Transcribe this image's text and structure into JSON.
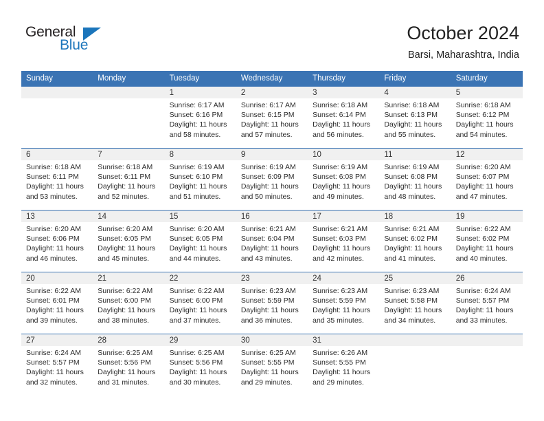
{
  "brand": {
    "name_top": "General",
    "name_bottom": "Blue",
    "triangle_icon": "triangle-icon",
    "color_top": "#231f20",
    "color_bottom": "#1b75bb"
  },
  "header": {
    "title": "October 2024",
    "subtitle": "Barsi, Maharashtra, India"
  },
  "theme": {
    "header_blue": "#3b74b4",
    "day_band_gray": "#f0f0f0",
    "text": "#2b2b2b"
  },
  "calendar": {
    "weekday_headers": [
      "Sunday",
      "Monday",
      "Tuesday",
      "Wednesday",
      "Thursday",
      "Friday",
      "Saturday"
    ],
    "weeks": [
      [
        {
          "day": "",
          "sunrise": "",
          "sunset": "",
          "daylight_line1": "",
          "daylight_line2": ""
        },
        {
          "day": "",
          "sunrise": "",
          "sunset": "",
          "daylight_line1": "",
          "daylight_line2": ""
        },
        {
          "day": "1",
          "sunrise": "Sunrise: 6:17 AM",
          "sunset": "Sunset: 6:16 PM",
          "daylight_line1": "Daylight: 11 hours",
          "daylight_line2": "and 58 minutes."
        },
        {
          "day": "2",
          "sunrise": "Sunrise: 6:17 AM",
          "sunset": "Sunset: 6:15 PM",
          "daylight_line1": "Daylight: 11 hours",
          "daylight_line2": "and 57 minutes."
        },
        {
          "day": "3",
          "sunrise": "Sunrise: 6:18 AM",
          "sunset": "Sunset: 6:14 PM",
          "daylight_line1": "Daylight: 11 hours",
          "daylight_line2": "and 56 minutes."
        },
        {
          "day": "4",
          "sunrise": "Sunrise: 6:18 AM",
          "sunset": "Sunset: 6:13 PM",
          "daylight_line1": "Daylight: 11 hours",
          "daylight_line2": "and 55 minutes."
        },
        {
          "day": "5",
          "sunrise": "Sunrise: 6:18 AM",
          "sunset": "Sunset: 6:12 PM",
          "daylight_line1": "Daylight: 11 hours",
          "daylight_line2": "and 54 minutes."
        }
      ],
      [
        {
          "day": "6",
          "sunrise": "Sunrise: 6:18 AM",
          "sunset": "Sunset: 6:11 PM",
          "daylight_line1": "Daylight: 11 hours",
          "daylight_line2": "and 53 minutes."
        },
        {
          "day": "7",
          "sunrise": "Sunrise: 6:18 AM",
          "sunset": "Sunset: 6:11 PM",
          "daylight_line1": "Daylight: 11 hours",
          "daylight_line2": "and 52 minutes."
        },
        {
          "day": "8",
          "sunrise": "Sunrise: 6:19 AM",
          "sunset": "Sunset: 6:10 PM",
          "daylight_line1": "Daylight: 11 hours",
          "daylight_line2": "and 51 minutes."
        },
        {
          "day": "9",
          "sunrise": "Sunrise: 6:19 AM",
          "sunset": "Sunset: 6:09 PM",
          "daylight_line1": "Daylight: 11 hours",
          "daylight_line2": "and 50 minutes."
        },
        {
          "day": "10",
          "sunrise": "Sunrise: 6:19 AM",
          "sunset": "Sunset: 6:08 PM",
          "daylight_line1": "Daylight: 11 hours",
          "daylight_line2": "and 49 minutes."
        },
        {
          "day": "11",
          "sunrise": "Sunrise: 6:19 AM",
          "sunset": "Sunset: 6:08 PM",
          "daylight_line1": "Daylight: 11 hours",
          "daylight_line2": "and 48 minutes."
        },
        {
          "day": "12",
          "sunrise": "Sunrise: 6:20 AM",
          "sunset": "Sunset: 6:07 PM",
          "daylight_line1": "Daylight: 11 hours",
          "daylight_line2": "and 47 minutes."
        }
      ],
      [
        {
          "day": "13",
          "sunrise": "Sunrise: 6:20 AM",
          "sunset": "Sunset: 6:06 PM",
          "daylight_line1": "Daylight: 11 hours",
          "daylight_line2": "and 46 minutes."
        },
        {
          "day": "14",
          "sunrise": "Sunrise: 6:20 AM",
          "sunset": "Sunset: 6:05 PM",
          "daylight_line1": "Daylight: 11 hours",
          "daylight_line2": "and 45 minutes."
        },
        {
          "day": "15",
          "sunrise": "Sunrise: 6:20 AM",
          "sunset": "Sunset: 6:05 PM",
          "daylight_line1": "Daylight: 11 hours",
          "daylight_line2": "and 44 minutes."
        },
        {
          "day": "16",
          "sunrise": "Sunrise: 6:21 AM",
          "sunset": "Sunset: 6:04 PM",
          "daylight_line1": "Daylight: 11 hours",
          "daylight_line2": "and 43 minutes."
        },
        {
          "day": "17",
          "sunrise": "Sunrise: 6:21 AM",
          "sunset": "Sunset: 6:03 PM",
          "daylight_line1": "Daylight: 11 hours",
          "daylight_line2": "and 42 minutes."
        },
        {
          "day": "18",
          "sunrise": "Sunrise: 6:21 AM",
          "sunset": "Sunset: 6:02 PM",
          "daylight_line1": "Daylight: 11 hours",
          "daylight_line2": "and 41 minutes."
        },
        {
          "day": "19",
          "sunrise": "Sunrise: 6:22 AM",
          "sunset": "Sunset: 6:02 PM",
          "daylight_line1": "Daylight: 11 hours",
          "daylight_line2": "and 40 minutes."
        }
      ],
      [
        {
          "day": "20",
          "sunrise": "Sunrise: 6:22 AM",
          "sunset": "Sunset: 6:01 PM",
          "daylight_line1": "Daylight: 11 hours",
          "daylight_line2": "and 39 minutes."
        },
        {
          "day": "21",
          "sunrise": "Sunrise: 6:22 AM",
          "sunset": "Sunset: 6:00 PM",
          "daylight_line1": "Daylight: 11 hours",
          "daylight_line2": "and 38 minutes."
        },
        {
          "day": "22",
          "sunrise": "Sunrise: 6:22 AM",
          "sunset": "Sunset: 6:00 PM",
          "daylight_line1": "Daylight: 11 hours",
          "daylight_line2": "and 37 minutes."
        },
        {
          "day": "23",
          "sunrise": "Sunrise: 6:23 AM",
          "sunset": "Sunset: 5:59 PM",
          "daylight_line1": "Daylight: 11 hours",
          "daylight_line2": "and 36 minutes."
        },
        {
          "day": "24",
          "sunrise": "Sunrise: 6:23 AM",
          "sunset": "Sunset: 5:59 PM",
          "daylight_line1": "Daylight: 11 hours",
          "daylight_line2": "and 35 minutes."
        },
        {
          "day": "25",
          "sunrise": "Sunrise: 6:23 AM",
          "sunset": "Sunset: 5:58 PM",
          "daylight_line1": "Daylight: 11 hours",
          "daylight_line2": "and 34 minutes."
        },
        {
          "day": "26",
          "sunrise": "Sunrise: 6:24 AM",
          "sunset": "Sunset: 5:57 PM",
          "daylight_line1": "Daylight: 11 hours",
          "daylight_line2": "and 33 minutes."
        }
      ],
      [
        {
          "day": "27",
          "sunrise": "Sunrise: 6:24 AM",
          "sunset": "Sunset: 5:57 PM",
          "daylight_line1": "Daylight: 11 hours",
          "daylight_line2": "and 32 minutes."
        },
        {
          "day": "28",
          "sunrise": "Sunrise: 6:25 AM",
          "sunset": "Sunset: 5:56 PM",
          "daylight_line1": "Daylight: 11 hours",
          "daylight_line2": "and 31 minutes."
        },
        {
          "day": "29",
          "sunrise": "Sunrise: 6:25 AM",
          "sunset": "Sunset: 5:56 PM",
          "daylight_line1": "Daylight: 11 hours",
          "daylight_line2": "and 30 minutes."
        },
        {
          "day": "30",
          "sunrise": "Sunrise: 6:25 AM",
          "sunset": "Sunset: 5:55 PM",
          "daylight_line1": "Daylight: 11 hours",
          "daylight_line2": "and 29 minutes."
        },
        {
          "day": "31",
          "sunrise": "Sunrise: 6:26 AM",
          "sunset": "Sunset: 5:55 PM",
          "daylight_line1": "Daylight: 11 hours",
          "daylight_line2": "and 29 minutes."
        },
        {
          "day": "",
          "sunrise": "",
          "sunset": "",
          "daylight_line1": "",
          "daylight_line2": ""
        },
        {
          "day": "",
          "sunrise": "",
          "sunset": "",
          "daylight_line1": "",
          "daylight_line2": ""
        }
      ]
    ]
  }
}
